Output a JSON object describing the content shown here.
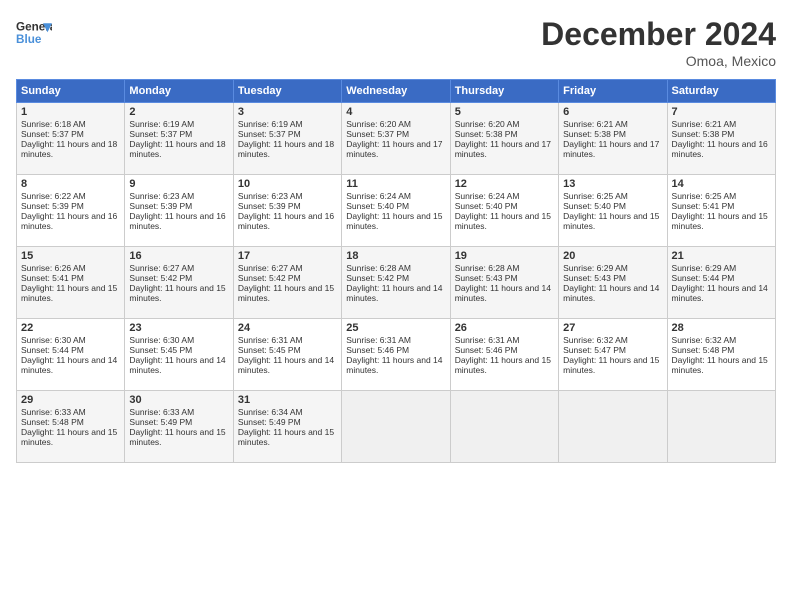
{
  "header": {
    "title": "December 2024",
    "location": "Omoa, Mexico"
  },
  "days": [
    "Sunday",
    "Monday",
    "Tuesday",
    "Wednesday",
    "Thursday",
    "Friday",
    "Saturday"
  ],
  "weeks": [
    [
      {
        "day": 1,
        "sunrise": "Sunrise: 6:18 AM",
        "sunset": "Sunset: 5:37 PM",
        "daylight": "Daylight: 11 hours and 18 minutes."
      },
      {
        "day": 2,
        "sunrise": "Sunrise: 6:19 AM",
        "sunset": "Sunset: 5:37 PM",
        "daylight": "Daylight: 11 hours and 18 minutes."
      },
      {
        "day": 3,
        "sunrise": "Sunrise: 6:19 AM",
        "sunset": "Sunset: 5:37 PM",
        "daylight": "Daylight: 11 hours and 18 minutes."
      },
      {
        "day": 4,
        "sunrise": "Sunrise: 6:20 AM",
        "sunset": "Sunset: 5:37 PM",
        "daylight": "Daylight: 11 hours and 17 minutes."
      },
      {
        "day": 5,
        "sunrise": "Sunrise: 6:20 AM",
        "sunset": "Sunset: 5:38 PM",
        "daylight": "Daylight: 11 hours and 17 minutes."
      },
      {
        "day": 6,
        "sunrise": "Sunrise: 6:21 AM",
        "sunset": "Sunset: 5:38 PM",
        "daylight": "Daylight: 11 hours and 17 minutes."
      },
      {
        "day": 7,
        "sunrise": "Sunrise: 6:21 AM",
        "sunset": "Sunset: 5:38 PM",
        "daylight": "Daylight: 11 hours and 16 minutes."
      }
    ],
    [
      {
        "day": 8,
        "sunrise": "Sunrise: 6:22 AM",
        "sunset": "Sunset: 5:39 PM",
        "daylight": "Daylight: 11 hours and 16 minutes."
      },
      {
        "day": 9,
        "sunrise": "Sunrise: 6:23 AM",
        "sunset": "Sunset: 5:39 PM",
        "daylight": "Daylight: 11 hours and 16 minutes."
      },
      {
        "day": 10,
        "sunrise": "Sunrise: 6:23 AM",
        "sunset": "Sunset: 5:39 PM",
        "daylight": "Daylight: 11 hours and 16 minutes."
      },
      {
        "day": 11,
        "sunrise": "Sunrise: 6:24 AM",
        "sunset": "Sunset: 5:40 PM",
        "daylight": "Daylight: 11 hours and 15 minutes."
      },
      {
        "day": 12,
        "sunrise": "Sunrise: 6:24 AM",
        "sunset": "Sunset: 5:40 PM",
        "daylight": "Daylight: 11 hours and 15 minutes."
      },
      {
        "day": 13,
        "sunrise": "Sunrise: 6:25 AM",
        "sunset": "Sunset: 5:40 PM",
        "daylight": "Daylight: 11 hours and 15 minutes."
      },
      {
        "day": 14,
        "sunrise": "Sunrise: 6:25 AM",
        "sunset": "Sunset: 5:41 PM",
        "daylight": "Daylight: 11 hours and 15 minutes."
      }
    ],
    [
      {
        "day": 15,
        "sunrise": "Sunrise: 6:26 AM",
        "sunset": "Sunset: 5:41 PM",
        "daylight": "Daylight: 11 hours and 15 minutes."
      },
      {
        "day": 16,
        "sunrise": "Sunrise: 6:27 AM",
        "sunset": "Sunset: 5:42 PM",
        "daylight": "Daylight: 11 hours and 15 minutes."
      },
      {
        "day": 17,
        "sunrise": "Sunrise: 6:27 AM",
        "sunset": "Sunset: 5:42 PM",
        "daylight": "Daylight: 11 hours and 15 minutes."
      },
      {
        "day": 18,
        "sunrise": "Sunrise: 6:28 AM",
        "sunset": "Sunset: 5:42 PM",
        "daylight": "Daylight: 11 hours and 14 minutes."
      },
      {
        "day": 19,
        "sunrise": "Sunrise: 6:28 AM",
        "sunset": "Sunset: 5:43 PM",
        "daylight": "Daylight: 11 hours and 14 minutes."
      },
      {
        "day": 20,
        "sunrise": "Sunrise: 6:29 AM",
        "sunset": "Sunset: 5:43 PM",
        "daylight": "Daylight: 11 hours and 14 minutes."
      },
      {
        "day": 21,
        "sunrise": "Sunrise: 6:29 AM",
        "sunset": "Sunset: 5:44 PM",
        "daylight": "Daylight: 11 hours and 14 minutes."
      }
    ],
    [
      {
        "day": 22,
        "sunrise": "Sunrise: 6:30 AM",
        "sunset": "Sunset: 5:44 PM",
        "daylight": "Daylight: 11 hours and 14 minutes."
      },
      {
        "day": 23,
        "sunrise": "Sunrise: 6:30 AM",
        "sunset": "Sunset: 5:45 PM",
        "daylight": "Daylight: 11 hours and 14 minutes."
      },
      {
        "day": 24,
        "sunrise": "Sunrise: 6:31 AM",
        "sunset": "Sunset: 5:45 PM",
        "daylight": "Daylight: 11 hours and 14 minutes."
      },
      {
        "day": 25,
        "sunrise": "Sunrise: 6:31 AM",
        "sunset": "Sunset: 5:46 PM",
        "daylight": "Daylight: 11 hours and 14 minutes."
      },
      {
        "day": 26,
        "sunrise": "Sunrise: 6:31 AM",
        "sunset": "Sunset: 5:46 PM",
        "daylight": "Daylight: 11 hours and 15 minutes."
      },
      {
        "day": 27,
        "sunrise": "Sunrise: 6:32 AM",
        "sunset": "Sunset: 5:47 PM",
        "daylight": "Daylight: 11 hours and 15 minutes."
      },
      {
        "day": 28,
        "sunrise": "Sunrise: 6:32 AM",
        "sunset": "Sunset: 5:48 PM",
        "daylight": "Daylight: 11 hours and 15 minutes."
      }
    ],
    [
      {
        "day": 29,
        "sunrise": "Sunrise: 6:33 AM",
        "sunset": "Sunset: 5:48 PM",
        "daylight": "Daylight: 11 hours and 15 minutes."
      },
      {
        "day": 30,
        "sunrise": "Sunrise: 6:33 AM",
        "sunset": "Sunset: 5:49 PM",
        "daylight": "Daylight: 11 hours and 15 minutes."
      },
      {
        "day": 31,
        "sunrise": "Sunrise: 6:34 AM",
        "sunset": "Sunset: 5:49 PM",
        "daylight": "Daylight: 11 hours and 15 minutes."
      },
      null,
      null,
      null,
      null
    ]
  ]
}
